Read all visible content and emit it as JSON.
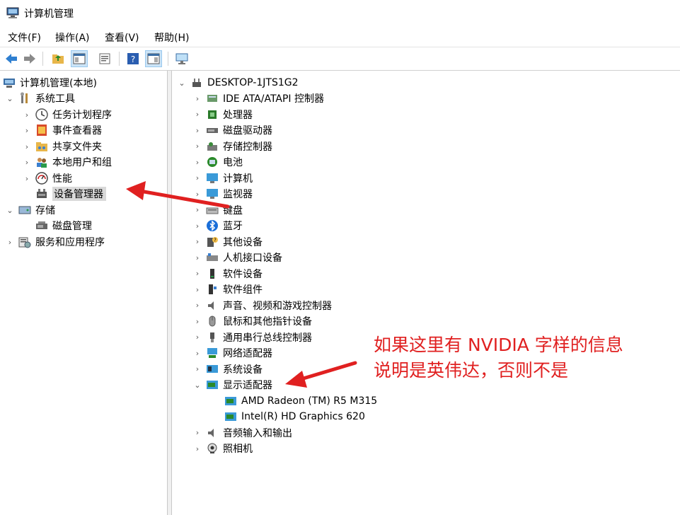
{
  "window": {
    "title": "计算机管理"
  },
  "menu": [
    "文件(F)",
    "操作(A)",
    "查看(V)",
    "帮助(H)"
  ],
  "toolbar": {
    "icons": [
      "back-arrow-icon",
      "forward-arrow-icon",
      "up-folder-icon",
      "show-hide-tree-icon",
      "properties-icon",
      "help-icon",
      "action-pane-icon",
      "monitor-icon"
    ]
  },
  "left_tree": {
    "root": "计算机管理(本地)",
    "system_tools": "系统工具",
    "task_scheduler": "任务计划程序",
    "event_viewer": "事件查看器",
    "shared_folders": "共享文件夹",
    "local_users": "本地用户和组",
    "performance": "性能",
    "device_manager": "设备管理器",
    "storage": "存储",
    "disk_management": "磁盘管理",
    "services_apps": "服务和应用程序"
  },
  "devices": {
    "computer_name": "DESKTOP-1JTS1G2",
    "categories": [
      "IDE ATA/ATAPI 控制器",
      "处理器",
      "磁盘驱动器",
      "存储控制器",
      "电池",
      "计算机",
      "监视器",
      "键盘",
      "蓝牙",
      "其他设备",
      "人机接口设备",
      "软件设备",
      "软件组件",
      "声音、视频和游戏控制器",
      "鼠标和其他指针设备",
      "通用串行总线控制器",
      "网络适配器",
      "系统设备",
      "显示适配器"
    ],
    "display_adapters": [
      "AMD Radeon (TM) R5 M315",
      "Intel(R) HD Graphics 620"
    ],
    "after": [
      "音频输入和输出",
      "照相机"
    ]
  },
  "annotation": {
    "line1": "如果这里有 NVIDIA 字样的信息",
    "line2": "说明是英伟达，否则不是",
    "color": "#e02020"
  }
}
